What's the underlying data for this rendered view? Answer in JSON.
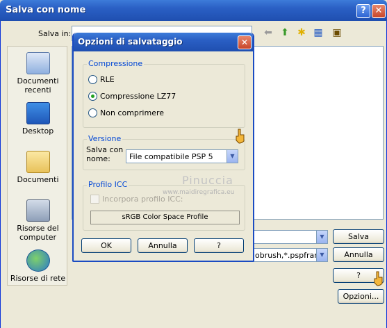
{
  "back_window": {
    "title": "Salva con nome",
    "help_button": "?",
    "close_button": "✕",
    "save_in_label": "Salva in:",
    "filetype_value": "obrush,*.pspframe,",
    "places": [
      {
        "label": "Documenti recenti",
        "icon": "recent-documents-icon"
      },
      {
        "label": "Desktop",
        "icon": "desktop-icon"
      },
      {
        "label": "Documenti",
        "icon": "documents-folder-icon"
      },
      {
        "label": "Risorse del computer",
        "icon": "my-computer-icon"
      },
      {
        "label": "Risorse di rete",
        "icon": "network-places-icon"
      }
    ],
    "buttons": {
      "save": "Salva",
      "cancel": "Annulla",
      "help": "?",
      "options": "Opzioni..."
    }
  },
  "dialog": {
    "title": "Opzioni di salvataggio",
    "close_button": "✕",
    "compression": {
      "label": "Compressione",
      "options": [
        "RLE",
        "Compressione LZ77",
        "Non comprimere"
      ],
      "selected": "Compressione LZ77"
    },
    "version": {
      "label": "Versione",
      "field_label": "Salva con nome:",
      "value": "File compatibile PSP 5"
    },
    "icc": {
      "label": "Profilo ICC",
      "checkbox_label": "Incorpora profilo ICC:",
      "checked": false,
      "profile_button": "sRGB Color Space Profile"
    },
    "buttons": {
      "ok": "OK",
      "cancel": "Annulla",
      "help": "?"
    }
  },
  "watermark": {
    "name": "Pinuccia",
    "site": "www.maidiregrafica.eu"
  },
  "colors": {
    "titlebar": "#2a5fc4",
    "face": "#ece9d8",
    "group_label": "#0046d5"
  }
}
